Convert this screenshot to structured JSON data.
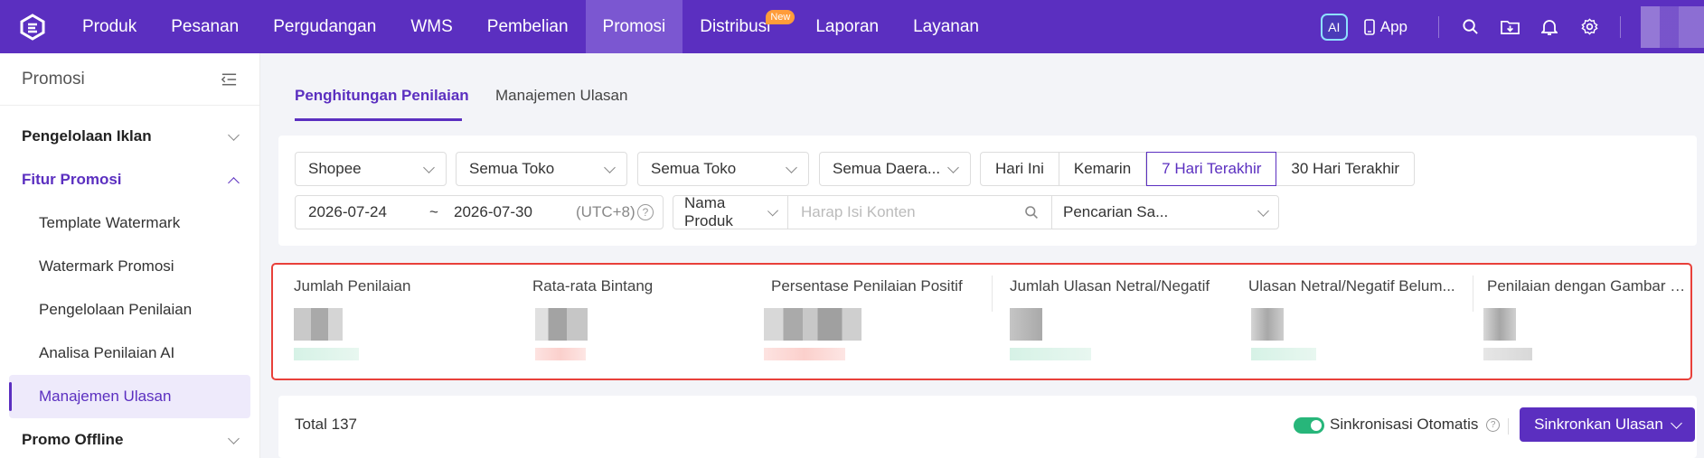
{
  "nav": {
    "items": [
      {
        "label": "Produk"
      },
      {
        "label": "Pesanan"
      },
      {
        "label": "Pergudangan"
      },
      {
        "label": "WMS"
      },
      {
        "label": "Pembelian"
      },
      {
        "label": "Promosi",
        "active": true
      },
      {
        "label": "Distribusi",
        "badge": "New"
      },
      {
        "label": "Laporan"
      },
      {
        "label": "Layanan"
      }
    ],
    "ai_label": "AI",
    "app_label": "App",
    "accent": "#5b2fc0"
  },
  "sidebar": {
    "title": "Promosi",
    "groups": [
      {
        "label": "Pengelolaan Iklan",
        "expanded": false
      },
      {
        "label": "Fitur Promosi",
        "expanded": true,
        "items": [
          {
            "label": "Template Watermark"
          },
          {
            "label": "Watermark Promosi"
          },
          {
            "label": "Pengelolaan Penilaian"
          },
          {
            "label": "Analisa Penilaian AI"
          },
          {
            "label": "Manajemen Ulasan",
            "active": true
          }
        ]
      },
      {
        "label": "Promo Offline",
        "expanded": false
      }
    ]
  },
  "tabs": [
    {
      "label": "Penghitungan Penilaian",
      "active": true
    },
    {
      "label": "Manajemen Ulasan"
    }
  ],
  "filters": {
    "platform": "Shopee",
    "store1": "Semua Toko",
    "store2": "Semua Toko",
    "region": "Semua Daera...",
    "ranges": [
      "Hari Ini",
      "Kemarin",
      "7 Hari Terakhir",
      "30 Hari Terakhir"
    ],
    "active_range": "7 Hari Terakhir",
    "date_start": "2026-07-24",
    "date_sep": "~",
    "date_end": "2026-07-30",
    "timezone": "(UTC+8)",
    "search_field": "Nama Produk",
    "search_placeholder": "Harap Isi Konten",
    "search_mode": "Pencarian Sa..."
  },
  "stats": [
    {
      "label": "Jumlah Penilaian"
    },
    {
      "label": "Rata-rata Bintang"
    },
    {
      "label": "Persentase Penilaian Positif"
    },
    {
      "label": "Jumlah Ulasan Netral/Negatif"
    },
    {
      "label": "Ulasan Netral/Negatif Belum..."
    },
    {
      "label": "Penilaian dengan Gambar at..."
    }
  ],
  "footer": {
    "total": "Total 137",
    "auto_sync_label": "Sinkronisasi Otomatis",
    "auto_sync_on": true,
    "sync_button": "Sinkronkan Ulasan"
  }
}
